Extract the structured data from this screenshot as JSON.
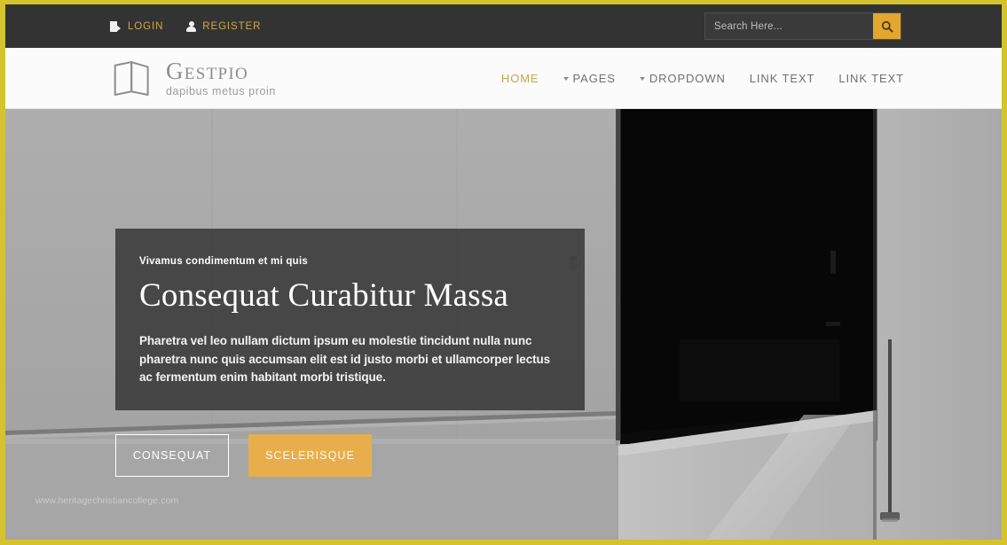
{
  "theme": {
    "page_border": "#d4c22e",
    "topbar_bg": "#333333",
    "accent_gold": "#e3a72e",
    "link_gold": "#d1a848",
    "nav_active": "#c8a550",
    "button_amber": "#e8ae4c"
  },
  "topbar": {
    "login_label": "LOGIN",
    "register_label": "REGISTER",
    "login_icon": "login-arrow-icon",
    "register_icon": "user-icon",
    "search": {
      "placeholder": "Search Here...",
      "value": "",
      "button_icon": "search-icon"
    }
  },
  "brand": {
    "logo_icon": "folded-map-icon",
    "name": "Gestpio",
    "tagline": "dapibus metus proin"
  },
  "nav": {
    "items": [
      {
        "label": "HOME",
        "has_caret": false,
        "active": true
      },
      {
        "label": "PAGES",
        "has_caret": true,
        "active": false
      },
      {
        "label": "DROPDOWN",
        "has_caret": true,
        "active": false
      },
      {
        "label": "LINK TEXT",
        "has_caret": false,
        "active": false
      },
      {
        "label": "LINK TEXT",
        "has_caret": false,
        "active": false
      }
    ]
  },
  "hero": {
    "eyebrow": "Vivamus condimentum et mi quis",
    "title": "Consequat Curabitur Massa",
    "description": "Pharetra vel leo nullam dictum ipsum eu molestie tincidunt nulla nunc pharetra nunc quis accumsan elit est id justo morbi et ullamcorper lectus ac fermentum enim habitant morbi tristique.",
    "primary_button": "CONSEQUAT",
    "secondary_button": "SCELERISQUE",
    "watermark": "www.heritagechristiancollege.com"
  }
}
